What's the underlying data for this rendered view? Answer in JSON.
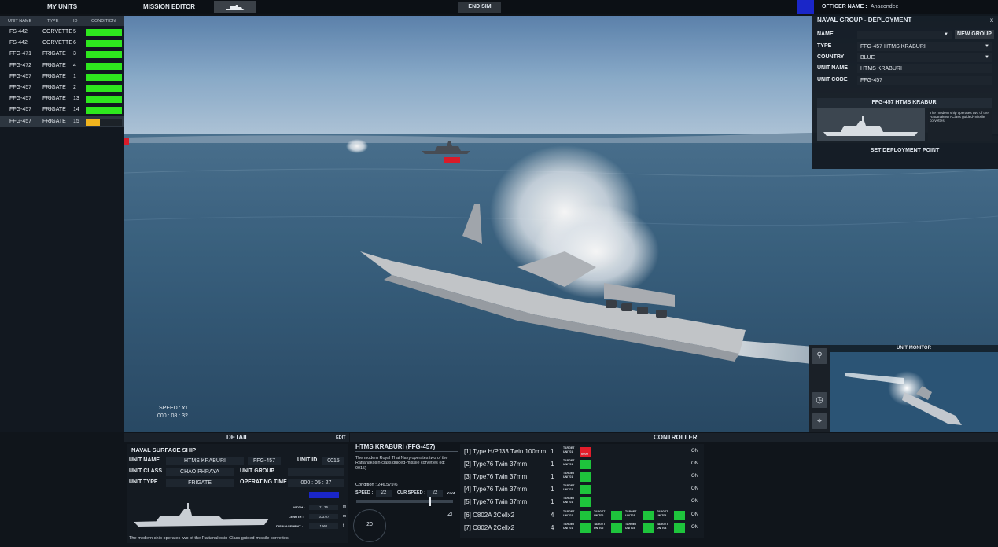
{
  "topbar": {
    "my_units": "MY UNITS",
    "mission_editor": "MISSION EDITOR",
    "end_sim": "END SIM",
    "officer_label": "OFFICER NAME :",
    "officer_name": "Anacondee"
  },
  "unit_table": {
    "headers": [
      "UNIT NAME",
      "TYPE",
      "ID",
      "CONDITION"
    ],
    "rows": [
      {
        "name": "FS-442",
        "type": "CORVETTE",
        "id": "5",
        "condition": 1.0,
        "color": "#2ee81e"
      },
      {
        "name": "FS-442",
        "type": "CORVETTE",
        "id": "6",
        "condition": 1.0,
        "color": "#2ee81e"
      },
      {
        "name": "FFG-471",
        "type": "FRIGATE",
        "id": "3",
        "condition": 1.0,
        "color": "#2ee81e"
      },
      {
        "name": "FFG-472",
        "type": "FRIGATE",
        "id": "4",
        "condition": 1.0,
        "color": "#2ee81e"
      },
      {
        "name": "FFG-457",
        "type": "FRIGATE",
        "id": "1",
        "condition": 1.0,
        "color": "#2ee81e"
      },
      {
        "name": "FFG-457",
        "type": "FRIGATE",
        "id": "2",
        "condition": 1.0,
        "color": "#2ee81e"
      },
      {
        "name": "FFG-457",
        "type": "FRIGATE",
        "id": "13",
        "condition": 1.0,
        "color": "#2ee81e"
      },
      {
        "name": "FFG-457",
        "type": "FRIGATE",
        "id": "14",
        "condition": 1.0,
        "color": "#2ee81e"
      },
      {
        "name": "FFG-457",
        "type": "FRIGATE",
        "id": "15",
        "condition": 0.4,
        "color": "#f0b41e"
      }
    ]
  },
  "scene": {
    "speed": "SPEED : x1",
    "time": "000 : 08 : 32"
  },
  "deployment": {
    "title": "NAVAL GROUP - DEPLOYMENT",
    "close": "x",
    "name_label": "NAME",
    "name_value": "",
    "new_group": "NEW GROUP",
    "type_label": "TYPE",
    "type_value": "FFG-457    HTMS KRABURI",
    "country_label": "COUNTRY",
    "country_value": "BLUE",
    "unit_name_label": "UNIT NAME",
    "unit_name_value": "HTMS KRABURI",
    "unit_code_label": "UNIT CODE",
    "unit_code_value": "FFG-457",
    "card_title": "FFG-457 HTMS KRABURI",
    "card_desc": "The modern ship operates two of the Rattanakosin-Class guided-missile corvettes",
    "set_point": "SET DEPLOYMENT POINT"
  },
  "monitor": {
    "title": "UNIT MONITOR"
  },
  "detail": {
    "title": "DETAIL",
    "edit": "EDIT",
    "section": "NAVAL SURFACE SHIP",
    "unit_name_label": "UNIT NAME",
    "unit_name": "HTMS KRABURI",
    "unit_code": "FFG-457",
    "unit_id_label": "UNIT ID",
    "unit_id": "0015",
    "unit_class_label": "UNIT CLASS",
    "unit_class": "CHAO PHRAYA",
    "unit_group_label": "UNIT GROUP",
    "unit_group": "",
    "unit_type_label": "UNIT TYPE",
    "unit_type": "FRIGATE",
    "op_time_label": "OPERATING TIME",
    "op_time": "000 : 05 : 27",
    "width_label": "WIDTH :",
    "width": "11.36",
    "width_unit": "m",
    "length_label": "LENGTH :",
    "length": "103.07",
    "length_unit": "m",
    "disp_label": "DISPLACEMENT :",
    "disp": "1961",
    "disp_unit": "t",
    "caption": "The modern ship operates two of the Rattanakosin-Class guided-missile corvettes"
  },
  "info": {
    "title": "HTMS KRABURI (FFG-457)",
    "desc": "The modern Royal Thai Navy operates two of the Rattanakosin-class guided-missile corvettes (id: 0015)",
    "condition": "Condition : 246.575%",
    "speed_label": "SPEED :",
    "speed": "22",
    "cur_speed_label": "CUR SPEED :",
    "cur_speed": "22",
    "knot": "Knot",
    "dial": "20"
  },
  "controller": {
    "title": "CONTROLLER",
    "weapons": [
      {
        "name": "[1] Type H/PJ33 Twin 100mm",
        "qty": "1",
        "targets": [
          {
            "label": "TARGET UNIT01",
            "state": "red",
            "tag": "0009"
          }
        ],
        "status": "ON"
      },
      {
        "name": "[2] Type76 Twin 37mm",
        "qty": "1",
        "targets": [
          {
            "label": "TARGET UNIT01",
            "state": "green",
            "tag": ""
          }
        ],
        "status": "ON"
      },
      {
        "name": "[3] Type76 Twin 37mm",
        "qty": "1",
        "targets": [
          {
            "label": "TARGET UNIT01",
            "state": "green",
            "tag": ""
          }
        ],
        "status": "ON"
      },
      {
        "name": "[4] Type76 Twin 37mm",
        "qty": "1",
        "targets": [
          {
            "label": "TARGET UNIT01",
            "state": "green",
            "tag": ""
          }
        ],
        "status": "ON"
      },
      {
        "name": "[5] Type76 Twin 37mm",
        "qty": "1",
        "targets": [
          {
            "label": "TARGET UNIT01",
            "state": "green",
            "tag": ""
          }
        ],
        "status": "ON"
      },
      {
        "name": "[6] C802A 2Cellx2",
        "qty": "4",
        "targets": [
          {
            "label": "TARGET UNIT01",
            "state": "green",
            "tag": ""
          },
          {
            "label": "TARGET UNIT02",
            "state": "green",
            "tag": ""
          },
          {
            "label": "TARGET UNIT03",
            "state": "green",
            "tag": ""
          },
          {
            "label": "TARGET UNIT04",
            "state": "green",
            "tag": ""
          }
        ],
        "status": "ON"
      },
      {
        "name": "[7] C802A 2Cellx2",
        "qty": "4",
        "targets": [
          {
            "label": "TARGET UNIT01",
            "state": "green",
            "tag": ""
          },
          {
            "label": "TARGET UNIT02",
            "state": "green",
            "tag": ""
          },
          {
            "label": "TARGET UNIT03",
            "state": "green",
            "tag": ""
          },
          {
            "label": "TARGET UNIT04",
            "state": "green",
            "tag": ""
          }
        ],
        "status": "ON"
      }
    ]
  },
  "colors": {
    "ok": "#2ee81e",
    "warn": "#f0b41e",
    "alert": "#e21d2b",
    "target_green": "#1ec43c",
    "accent_blue": "#1a26c8"
  }
}
